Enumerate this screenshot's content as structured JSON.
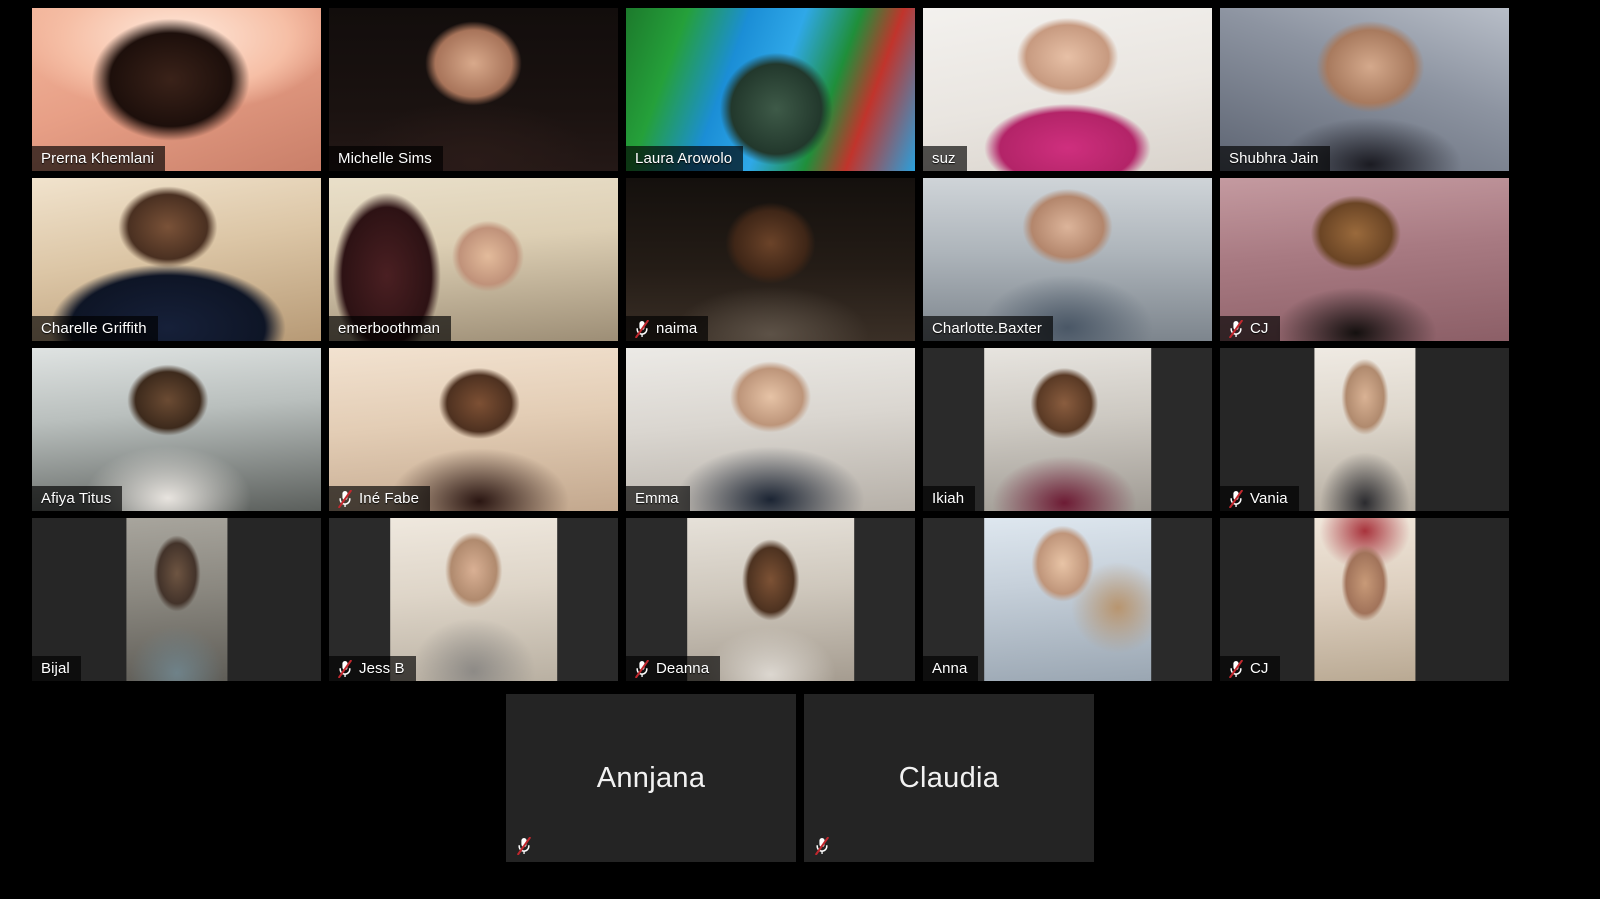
{
  "app": {
    "name": "Zoom Meeting",
    "view": "Gallery View"
  },
  "layout": {
    "columns": 5,
    "rows": 5,
    "background": "#000000",
    "active_speaker_border_color": "#b9d94a",
    "badge_background": "rgba(0,0,0,0.66)",
    "badge_text_color": "#ffffff",
    "muted_icon_slash_color": "#c0272d"
  },
  "icons": {
    "muted_mic": "muted-microphone-icon"
  },
  "participants": [
    {
      "name": "Prerna Khemlani",
      "muted": false,
      "video_on": true,
      "active_speaker": false,
      "row": 1,
      "col": 1,
      "bg": "bg-prerna",
      "fit": "cover"
    },
    {
      "name": "Michelle Sims",
      "muted": false,
      "video_on": true,
      "active_speaker": false,
      "row": 1,
      "col": 2,
      "bg": "bg-michelle",
      "fit": "cover"
    },
    {
      "name": "Laura Arowolo",
      "muted": false,
      "video_on": true,
      "active_speaker": false,
      "row": 1,
      "col": 3,
      "bg": "bg-laura",
      "fit": "cover",
      "virtual_background": true
    },
    {
      "name": "suz",
      "muted": false,
      "video_on": true,
      "active_speaker": false,
      "row": 1,
      "col": 4,
      "bg": "bg-suz",
      "fit": "cover"
    },
    {
      "name": "Shubhra Jain",
      "muted": false,
      "video_on": true,
      "active_speaker": false,
      "row": 1,
      "col": 5,
      "bg": "bg-shubhra",
      "fit": "cover"
    },
    {
      "name": "Charelle Griffith",
      "muted": false,
      "video_on": true,
      "active_speaker": false,
      "row": 2,
      "col": 1,
      "bg": "bg-charelle",
      "fit": "cover"
    },
    {
      "name": "emerboothman",
      "muted": false,
      "video_on": true,
      "active_speaker": true,
      "row": 2,
      "col": 2,
      "bg": "bg-emer",
      "fit": "cover"
    },
    {
      "name": "naima",
      "muted": true,
      "video_on": true,
      "active_speaker": false,
      "row": 2,
      "col": 3,
      "bg": "bg-naima",
      "fit": "cover"
    },
    {
      "name": "Charlotte.Baxter",
      "muted": false,
      "video_on": true,
      "active_speaker": false,
      "row": 2,
      "col": 4,
      "bg": "bg-charlotte",
      "fit": "cover"
    },
    {
      "name": "CJ",
      "muted": true,
      "video_on": true,
      "active_speaker": false,
      "row": 2,
      "col": 5,
      "bg": "bg-cj1",
      "fit": "cover"
    },
    {
      "name": "Afiya Titus",
      "muted": false,
      "video_on": true,
      "active_speaker": false,
      "row": 3,
      "col": 1,
      "bg": "bg-afiya",
      "fit": "cover"
    },
    {
      "name": "Iné Fabe",
      "muted": true,
      "video_on": true,
      "active_speaker": false,
      "row": 3,
      "col": 2,
      "bg": "bg-ine",
      "fit": "cover"
    },
    {
      "name": "Emma",
      "muted": false,
      "video_on": true,
      "active_speaker": false,
      "row": 3,
      "col": 3,
      "bg": "bg-emma",
      "fit": "cover"
    },
    {
      "name": "Ikiah",
      "muted": false,
      "video_on": true,
      "active_speaker": false,
      "row": 3,
      "col": 4,
      "bg": "bg-ikiah",
      "fit": "pillar-wide"
    },
    {
      "name": "Vania",
      "muted": true,
      "video_on": true,
      "active_speaker": false,
      "row": 3,
      "col": 5,
      "bg": "bg-vania",
      "fit": "pillar"
    },
    {
      "name": "Bijal",
      "muted": false,
      "video_on": true,
      "active_speaker": false,
      "row": 4,
      "col": 1,
      "bg": "bg-bijal",
      "fit": "pillar"
    },
    {
      "name": "Jess B",
      "muted": true,
      "video_on": true,
      "active_speaker": false,
      "row": 4,
      "col": 2,
      "bg": "bg-jess",
      "fit": "pillar-wide"
    },
    {
      "name": "Deanna",
      "muted": true,
      "video_on": true,
      "active_speaker": false,
      "row": 4,
      "col": 3,
      "bg": "bg-deanna",
      "fit": "pillar-wide"
    },
    {
      "name": "Anna",
      "muted": false,
      "video_on": true,
      "active_speaker": false,
      "row": 4,
      "col": 4,
      "bg": "bg-anna",
      "fit": "pillar-wide"
    },
    {
      "name": "CJ",
      "muted": true,
      "video_on": true,
      "active_speaker": false,
      "row": 4,
      "col": 5,
      "bg": "bg-cj2",
      "fit": "pillar"
    },
    {
      "name": "Annjana",
      "muted": true,
      "video_on": false,
      "active_speaker": false,
      "row": 5,
      "col": 2,
      "bg": "",
      "fit": "off"
    },
    {
      "name": "Claudia",
      "muted": true,
      "video_on": false,
      "active_speaker": false,
      "row": 5,
      "col": 3,
      "bg": "",
      "fit": "off"
    }
  ]
}
